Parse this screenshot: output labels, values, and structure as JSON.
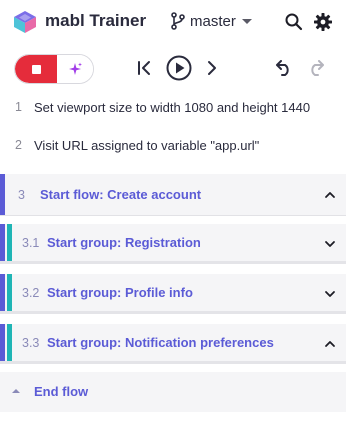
{
  "header": {
    "logo_icon": "mabl-logo-icon",
    "app_title": "mabl Trainer",
    "branch_icon": "git-branch-icon",
    "branch_label": "master",
    "search_icon": "search-icon",
    "settings_icon": "gear-icon"
  },
  "toolbar": {
    "record_icon": "stop-icon",
    "ai_icon": "sparkle-icon",
    "skip_back_icon": "skip-to-start-icon",
    "play_icon": "play-circle-icon",
    "forward_icon": "chevron-right-icon",
    "undo_icon": "undo-icon",
    "redo_icon": "redo-icon"
  },
  "steps": [
    {
      "num": "1",
      "text": "Set viewport size to width 1080 and height 1440"
    },
    {
      "num": "2",
      "text": "Visit URL assigned to variable \"app.url\""
    }
  ],
  "flow": {
    "num": "3",
    "label": "Start flow: Create account",
    "state": "expanded"
  },
  "groups": [
    {
      "num": "3.1",
      "label": "Start group: Registration",
      "state": "collapsed"
    },
    {
      "num": "3.2",
      "label": "Start group: Profile info",
      "state": "collapsed"
    },
    {
      "num": "3.3",
      "label": "Start group: Notification preferences",
      "state": "expanded"
    }
  ],
  "end_flow": {
    "label": "End flow"
  },
  "colors": {
    "accent": "#5b5bd6",
    "group_accent": "#1fb5b5",
    "record": "#e52c3b",
    "ai": "#a23ee8"
  }
}
